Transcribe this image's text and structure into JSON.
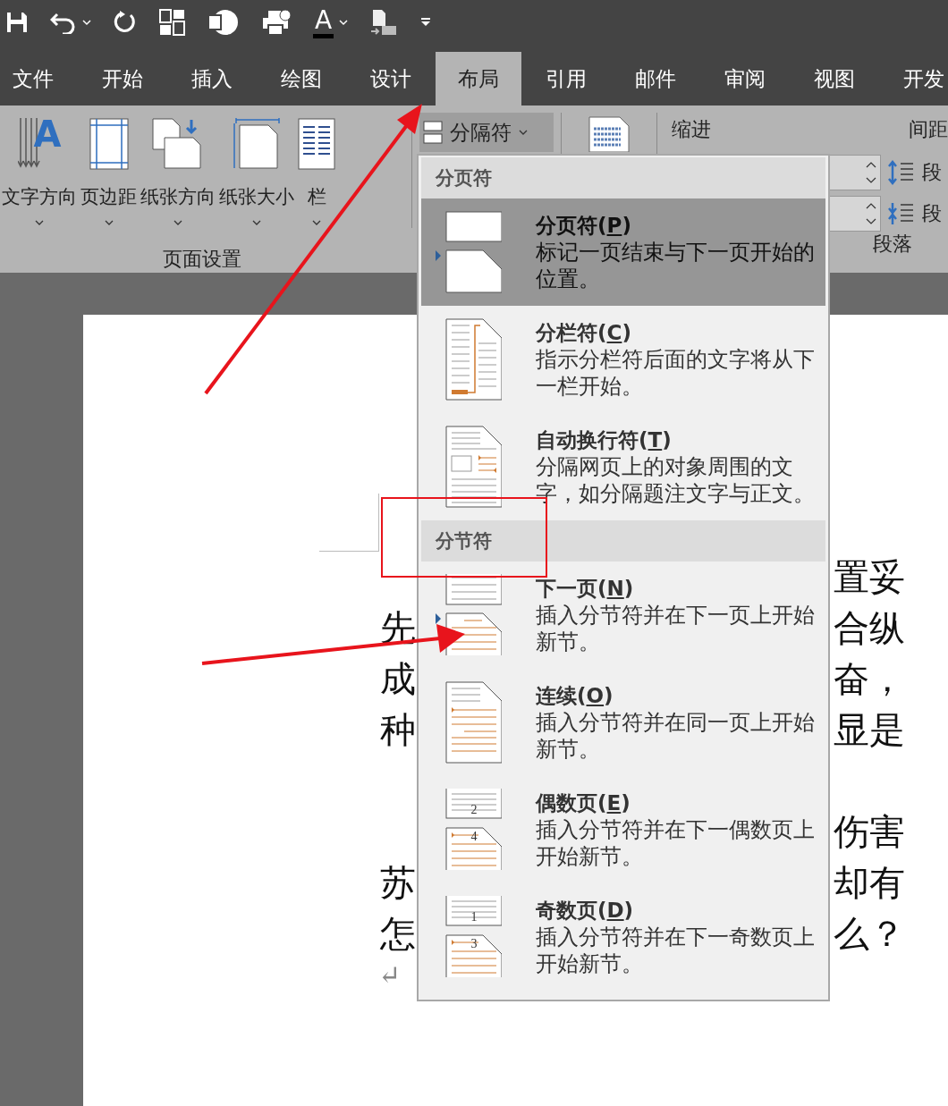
{
  "quick_access": [
    {
      "kind": "save"
    },
    {
      "kind": "undo"
    },
    {
      "kind": "dropdown"
    },
    {
      "kind": "redo"
    },
    {
      "kind": "layout"
    },
    {
      "kind": "presenter"
    },
    {
      "kind": "printer"
    },
    {
      "kind": "font-color",
      "glyph": "A"
    },
    {
      "kind": "dropdown"
    },
    {
      "kind": "mail"
    },
    {
      "kind": "customize"
    }
  ],
  "tabs": [
    {
      "label": "文件",
      "selected": false
    },
    {
      "label": "开始",
      "selected": false
    },
    {
      "label": "插入",
      "selected": false
    },
    {
      "label": "绘图",
      "selected": false
    },
    {
      "label": "设计",
      "selected": false
    },
    {
      "label": "布局",
      "selected": true
    },
    {
      "label": "引用",
      "selected": false
    },
    {
      "label": "邮件",
      "selected": false
    },
    {
      "label": "审阅",
      "selected": false
    },
    {
      "label": "视图",
      "selected": false
    },
    {
      "label": "开发",
      "selected": false
    }
  ],
  "ribbon": {
    "page_setup": {
      "label": "页面设置",
      "buttons": [
        {
          "label": "文字方向",
          "kind": "text-direction",
          "glyph": "A"
        },
        {
          "label": "页边距",
          "kind": "margins"
        },
        {
          "label": "纸张方向",
          "kind": "orientation"
        },
        {
          "label": "纸张大小",
          "kind": "size"
        },
        {
          "label": "栏",
          "kind": "columns"
        }
      ]
    },
    "breaks_button": {
      "label": "分隔符",
      "pressed": true
    },
    "paragraph": {
      "label": "段落",
      "indent_label": "缩进",
      "spacing_label": "间距",
      "spacing_rows": [
        {
          "kind": "before",
          "label": "段"
        },
        {
          "kind": "after",
          "label": "段"
        }
      ]
    }
  },
  "menu": {
    "sections": [
      {
        "header": "分页符",
        "items": [
          {
            "kind": "page",
            "title": "分页符(P)",
            "description": "标记一页结束与下一页开始的位置。",
            "selected": true
          },
          {
            "kind": "column",
            "title": "分栏符(C)",
            "description": "指示分栏符后面的文字将从下一栏开始。",
            "selected": false
          },
          {
            "kind": "wrap",
            "title": "自动换行符(T)",
            "description": "分隔网页上的对象周围的文字，如分隔题注文字与正文。",
            "selected": false
          }
        ]
      },
      {
        "header": "分节符",
        "items": [
          {
            "kind": "next-page",
            "title": "下一页(N)",
            "description": "插入分节符并在下一页上开始新节。",
            "selected": false
          },
          {
            "kind": "continuous",
            "title": "连续(O)",
            "description": "插入分节符并在同一页上开始新节。",
            "selected": false
          },
          {
            "kind": "even",
            "title": "偶数页(E)",
            "description": "插入分节符并在下一偶数页上开始新节。",
            "selected": false,
            "numbers": [
              "2",
              "4"
            ]
          },
          {
            "kind": "odd",
            "title": "奇数页(D)",
            "description": "插入分节符并在下一奇数页上开始新节。",
            "selected": false,
            "numbers": [
              "1",
              "3"
            ]
          }
        ]
      }
    ]
  },
  "document": {
    "lines": [
      {
        "right": "置妥"
      },
      {
        "left": "先",
        "right": "合纵"
      },
      {
        "left": "成",
        "right": "奋，"
      },
      {
        "left": "种",
        "right": "显是"
      },
      {
        "right": "伤害",
        "space_before": true
      },
      {
        "left": "苏",
        "right": "却有"
      },
      {
        "left": "怎",
        "right": "么？"
      }
    ],
    "end_mark": "↵"
  }
}
